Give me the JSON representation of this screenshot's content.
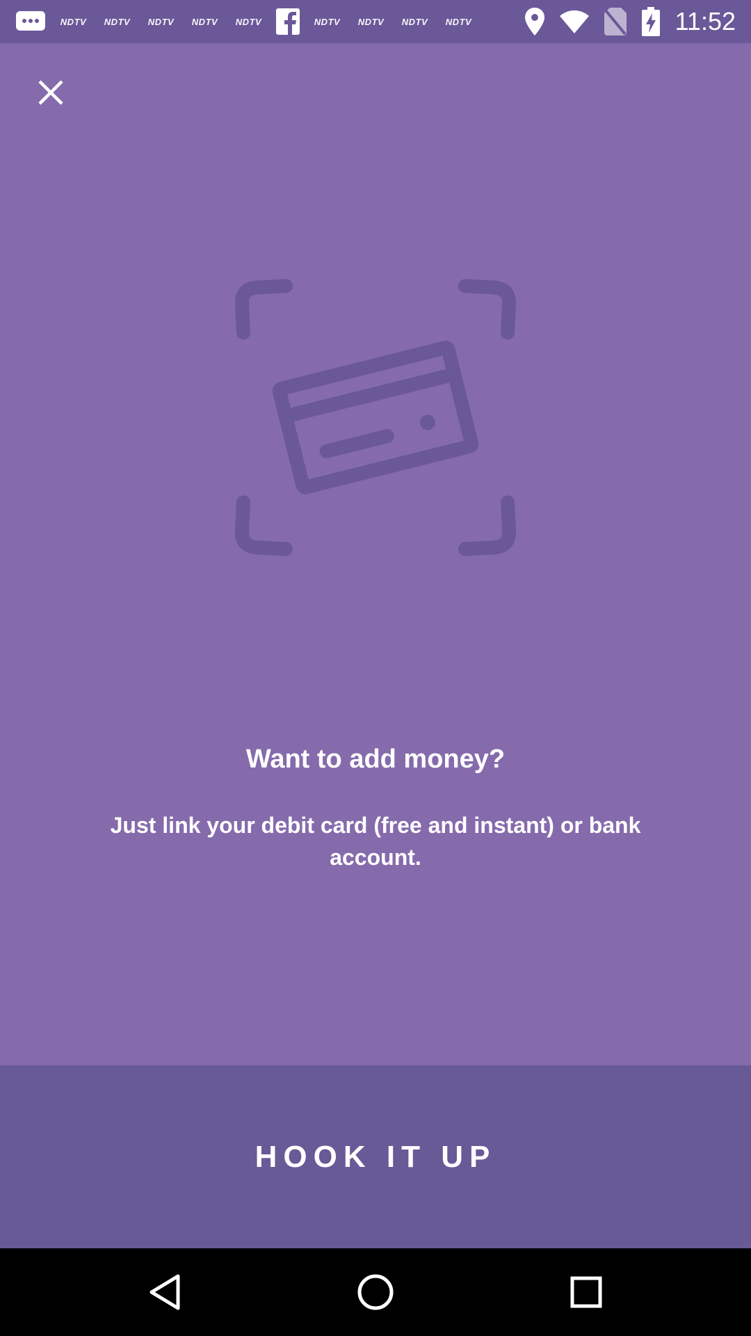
{
  "status_bar": {
    "time": "11:52",
    "notification_icons": [
      "messages-icon",
      "ndtv-icon",
      "ndtv-icon",
      "ndtv-icon",
      "ndtv-icon",
      "ndtv-icon",
      "facebook-icon",
      "ndtv-icon",
      "ndtv-icon",
      "ndtv-icon",
      "ndtv-icon"
    ],
    "ndtv_label": "NDTV",
    "system_icons": [
      "location-icon",
      "wifi-icon",
      "no-sim-icon",
      "battery-charging-icon"
    ]
  },
  "main": {
    "close_icon": "close-icon",
    "illustration_icon": "card-scan-icon",
    "headline": "Want to add money?",
    "subtext": "Just link your debit card (free and instant) or bank account."
  },
  "cta": {
    "label": "HOOK IT UP"
  },
  "nav_bar": {
    "items": [
      "back-icon",
      "home-icon",
      "recents-icon"
    ]
  },
  "colors": {
    "background": "#856bac",
    "status_bar": "#6a5898",
    "button": "#685997",
    "illustration": "#6a5898",
    "text": "#ffffff",
    "nav_bar": "#000000"
  }
}
